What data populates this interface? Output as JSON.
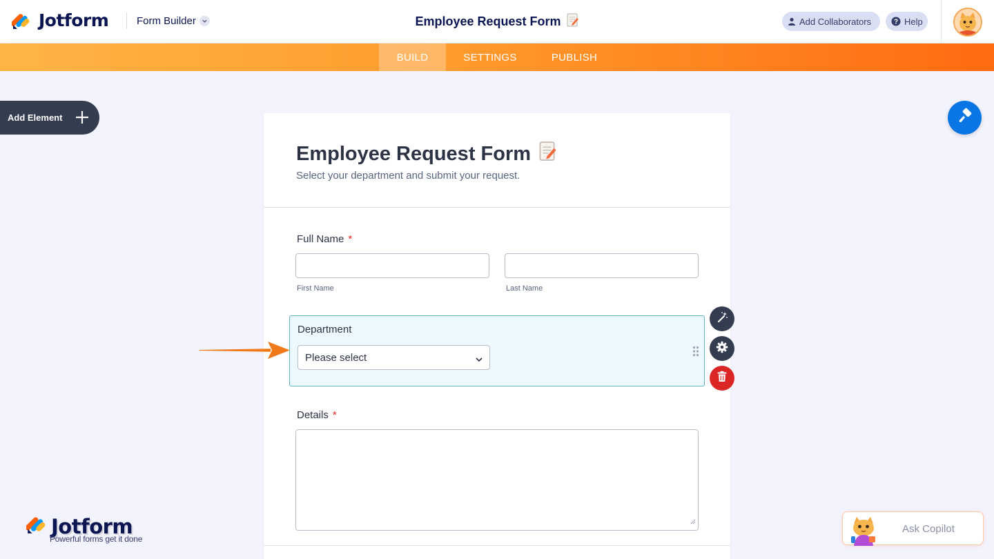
{
  "header": {
    "brand": "Jotform",
    "section": "Form Builder",
    "form_title": "Employee Request Form",
    "collaborators_label": "Add Collaborators",
    "help_label": "Help"
  },
  "nav": {
    "tabs": [
      {
        "label": "BUILD",
        "active": true
      },
      {
        "label": "SETTINGS",
        "active": false
      },
      {
        "label": "PUBLISH",
        "active": false
      }
    ]
  },
  "sidebar": {
    "add_element_label": "Add Element"
  },
  "form": {
    "title": "Employee Request Form",
    "subtitle": "Select your department and submit your request.",
    "fields": {
      "full_name": {
        "label": "Full Name",
        "required_mark": "*",
        "first_sublabel": "First Name",
        "last_sublabel": "Last Name",
        "first_value": "",
        "last_value": ""
      },
      "department": {
        "label": "Department",
        "selected": "Please select"
      },
      "details": {
        "label": "Details",
        "required_mark": "*",
        "value": ""
      }
    }
  },
  "footer_brand": {
    "name": "Jotform",
    "tagline": "Powerful forms get it done"
  },
  "copilot": {
    "label": "Ask Copilot"
  },
  "colors": {
    "accent_orange": "#ff6b10",
    "navy": "#0a1551",
    "blue": "#0a75e4",
    "danger": "#dc2626",
    "selected_field_bg": "#edf8ff"
  }
}
